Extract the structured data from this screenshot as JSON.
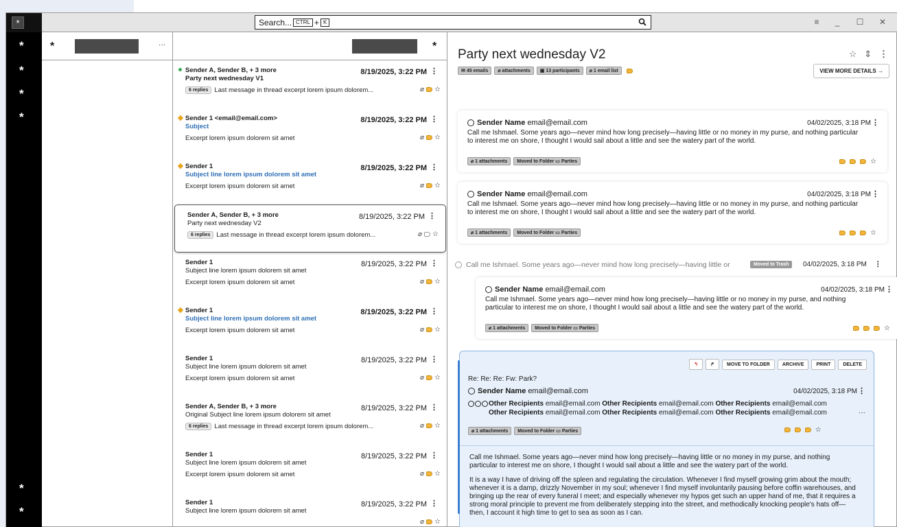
{
  "search": {
    "placeholder": "Search...",
    "kbd_ctrl": "CTRL",
    "kbd_plus": "+",
    "kbd_k": "K"
  },
  "window_controls": [
    "≡",
    "_",
    "☐",
    "✕"
  ],
  "rail": {
    "icons": [
      "*",
      "*",
      "*",
      "*",
      "*",
      "*"
    ]
  },
  "folders": {
    "star": "*",
    "more": "···"
  },
  "list": {
    "star": "*",
    "items": [
      {
        "dot": "green",
        "sender": "Sender A, Sender B, + 3 more",
        "subject": "Party next wednesday V1",
        "subject_style": "bold",
        "date": "8/19/2025, 3:22 PM",
        "date_bold": true,
        "badge": "6 replies",
        "excerpt": "Last message in thread excerpt lorem ipsum dolorem...",
        "tag": "filled"
      },
      {
        "dot": "diamond",
        "sender": "Sender 1 <email@email.com>",
        "subject": "Subject",
        "subject_style": "blue",
        "date": "8/19/2025, 3:22 PM",
        "date_bold": true,
        "badge": "",
        "excerpt": "Excerpt lorem ipsum dolorem sit amet",
        "tag": "filled"
      },
      {
        "dot": "diamond",
        "sender": "Sender 1",
        "subject": "Subject line lorem ipsum dolorem sit amet",
        "subject_style": "blue",
        "date": "8/19/2025, 3:22 PM",
        "date_bold": true,
        "badge": "",
        "excerpt": "Excerpt lorem ipsum dolorem sit amet",
        "tag": "filled"
      },
      {
        "dot": "",
        "sender": "Sender A, Sender B, + 3 more",
        "subject": "Party next wednesday V2",
        "subject_style": "normal",
        "date": "8/19/2025, 3:22 PM",
        "date_bold": false,
        "badge": "6 replies",
        "excerpt": "Last message in thread excerpt lorem ipsum dolorem...",
        "tag": "hollow",
        "selected": true
      },
      {
        "dot": "",
        "sender": "Sender 1",
        "subject": "Subject line lorem ipsum dolorem sit amet",
        "subject_style": "normal",
        "date": "8/19/2025, 3:22 PM",
        "date_bold": false,
        "badge": "",
        "excerpt": "Excerpt lorem ipsum dolorem sit amet",
        "tag": "filled"
      },
      {
        "dot": "diamond",
        "sender": "Sender 1",
        "subject": "Subject line lorem ipsum dolorem sit amet",
        "subject_style": "blue",
        "date": "8/19/2025, 3:22 PM",
        "date_bold": true,
        "badge": "",
        "excerpt": "Excerpt lorem ipsum dolorem sit amet",
        "tag": "filled"
      },
      {
        "dot": "",
        "sender": "Sender 1",
        "subject": "Subject line lorem ipsum dolorem sit amet",
        "subject_style": "normal",
        "date": "8/19/2025, 3:22 PM",
        "date_bold": false,
        "badge": "",
        "excerpt": "Excerpt lorem ipsum dolorem sit amet",
        "tag": "filled"
      },
      {
        "dot": "",
        "sender": "Sender A, Sender B, + 3 more",
        "subject": "Original Subject line lorem ipsum dolorem sit amet",
        "subject_style": "normal",
        "date": "8/19/2025, 3:22 PM",
        "date_bold": false,
        "badge": "6 replies",
        "excerpt": "Last message in thread excerpt lorem ipsum dolorem...",
        "tag": "filled"
      },
      {
        "dot": "",
        "sender": "Sender 1",
        "subject": "Subject line lorem ipsum dolorem sit amet",
        "subject_style": "normal",
        "date": "8/19/2025, 3:22 PM",
        "date_bold": false,
        "badge": "",
        "excerpt": "Excerpt lorem ipsum dolorem sit amet",
        "tag": "filled"
      },
      {
        "dot": "",
        "sender": "Sender 1",
        "subject": "Subject line lorem ipsum dolorem sit amet",
        "subject_style": "normal",
        "date": "8/19/2025, 3:22 PM",
        "date_bold": false,
        "badge": "",
        "excerpt": "",
        "tag": "filled"
      }
    ]
  },
  "reader": {
    "title": "Party next wednesday V2",
    "chips": [
      "45 emails",
      "attachments",
      "13 participants",
      "1 email list"
    ],
    "view_more": "VIEW MORE DETAILS",
    "sender_name": "Sender Name",
    "sender_email": "email@email.com",
    "date": "04/02/2025, 3:18 PM",
    "body_short": "Call me Ishmael. Some years ago—never mind how long precisely—having little or no money in my purse, and nothing particular to interest me on shore, I thought I would sail about a little and see the watery part of the world.",
    "attach_chip": "1 attachments",
    "moved_chip": "Moved to Folder",
    "folder_name": "Parties",
    "collapsed_text": "Call me Ishmael. Some years ago—never mind how long precisely—having little or",
    "moved_trash": "Moved to Trash",
    "active": {
      "actions": [
        "MOVE TO FOLDER",
        "ARCHIVE",
        "PRINT",
        "DELETE"
      ],
      "subject": "Re: Re: Re: Fw: Park?",
      "recipient_label": "Other Recipients",
      "recipient_email": "email@email.com",
      "more": "···",
      "body_p1": "Call me Ishmael. Some years ago—never mind how long precisely—having little or no money in my purse, and nothing particular to interest me on shore, I thought I would sail about a little and see the watery part of the world.",
      "body_p2": "It is a way I have of driving off the spleen and regulating the circulation. Whenever I find myself growing grim about the mouth; whenever it is a damp, drizzly November in my soul; whenever I find myself involuntarily pausing before coffin warehouses, and bringing up the rear of every funeral I meet; and especially whenever my hypos get such an upper hand of me, that it requires a strong moral principle to prevent me from deliberately stepping into the street, and methodically knocking people's hats off—then, I account it high time to get to sea as soon as I can."
    }
  }
}
